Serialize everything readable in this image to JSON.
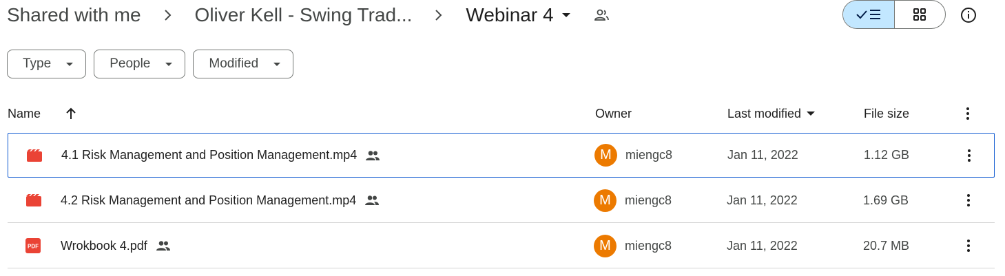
{
  "breadcrumb": {
    "items": [
      "Shared with me",
      "Oliver Kell - Swing Trad..."
    ],
    "current": "Webinar 4"
  },
  "filters": [
    {
      "label": "Type"
    },
    {
      "label": "People"
    },
    {
      "label": "Modified"
    }
  ],
  "columns": {
    "name": "Name",
    "owner": "Owner",
    "last_modified": "Last modified",
    "file_size": "File size"
  },
  "files": [
    {
      "name": "4.1 Risk Management and Position Management.mp4",
      "type_icon": "video-file-icon",
      "owner": "miengc8",
      "owner_initial": "M",
      "modified": "Jan 11, 2022",
      "size": "1.12 GB"
    },
    {
      "name": "4.2 Risk Management and Position Management.mp4",
      "type_icon": "video-file-icon",
      "owner": "miengc8",
      "owner_initial": "M",
      "modified": "Jan 11, 2022",
      "size": "1.69 GB"
    },
    {
      "name": "Wrokbook 4.pdf",
      "type_icon": "pdf-file-icon",
      "owner": "miengc8",
      "owner_initial": "M",
      "modified": "Jan 11, 2022",
      "size": "20.7 MB"
    }
  ],
  "icons": {
    "pdf_badge": "PDF"
  },
  "colors": {
    "accent_selected": "#c2e7ff",
    "selection_border": "#0b57d0",
    "avatar_bg": "#ec7a00",
    "video_icon": "#ea4335",
    "pdf_icon": "#ea4335"
  }
}
